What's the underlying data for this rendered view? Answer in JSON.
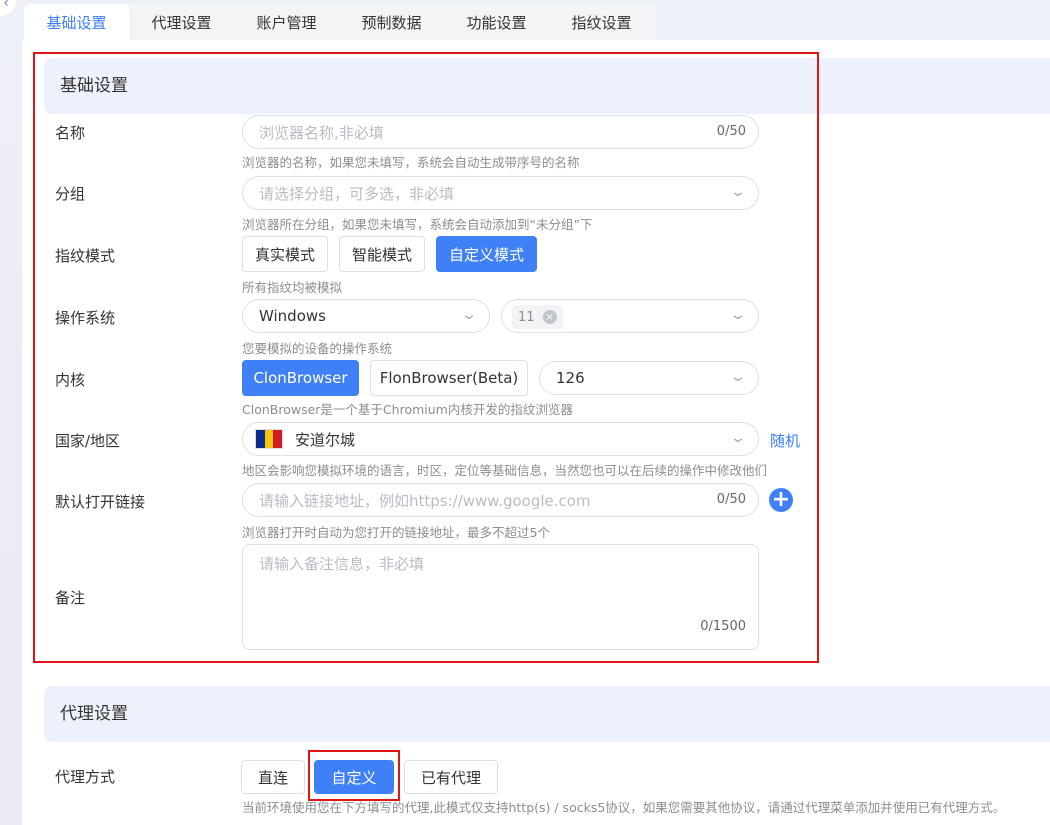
{
  "tabs": [
    "基础设置",
    "代理设置",
    "账户管理",
    "预制数据",
    "功能设置",
    "指纹设置"
  ],
  "basic": {
    "title": "基础设置",
    "name": {
      "label": "名称",
      "placeholder": "浏览器名称,非必填",
      "count": "0/50",
      "hint": "浏览器的名称，如果您未填写，系统会自动生成带序号的名称"
    },
    "group": {
      "label": "分组",
      "placeholder": "请选择分组，可多选，非必填",
      "hint": "浏览器所在分组，如果您未填写，系统会自动添加到“未分组”下"
    },
    "fingerprint": {
      "label": "指纹模式",
      "options": [
        "真实模式",
        "智能模式",
        "自定义模式"
      ],
      "selected": "自定义模式",
      "hint": "所有指纹均被模拟"
    },
    "os": {
      "label": "操作系统",
      "value": "Windows",
      "version_tag": "11",
      "hint": "您要模拟的设备的操作系统"
    },
    "kernel": {
      "label": "内核",
      "options": [
        "ClonBrowser",
        "FlonBrowser(Beta)"
      ],
      "selected": "ClonBrowser",
      "version": "126",
      "hint": "ClonBrowser是一个基于Chromium内核开发的指纹浏览器"
    },
    "country": {
      "label": "国家/地区",
      "value": "安道尔城",
      "flag": [
        "#0d2d8a",
        "#f2c712",
        "#d71a28"
      ],
      "random_label": "随机",
      "hint": "地区会影响您模拟环境的语言，时区，定位等基础信息，当然您也可以在后续的操作中修改他们"
    },
    "default_link": {
      "label": "默认打开链接",
      "placeholder": "请输入链接地址，例如https://www.google.com",
      "count": "0/50",
      "hint": "浏览器打开时自动为您打开的链接地址，最多不超过5个"
    },
    "remark": {
      "label": "备注",
      "placeholder": "请输入备注信息，非必填",
      "count": "0/1500"
    }
  },
  "proxy": {
    "title": "代理设置",
    "mode": {
      "label": "代理方式",
      "options": [
        "直连",
        "自定义",
        "已有代理"
      ],
      "selected": "自定义",
      "hint": "当前环境使用您在下方填写的代理,此模式仅支持http(s) / socks5协议，如果您需要其他协议，请通过代理菜单添加并使用已有代理方式。"
    }
  },
  "colors": {
    "accent": "#3f80f6",
    "highlight_border": "#e01515",
    "section_bg": "#edf1fb"
  }
}
